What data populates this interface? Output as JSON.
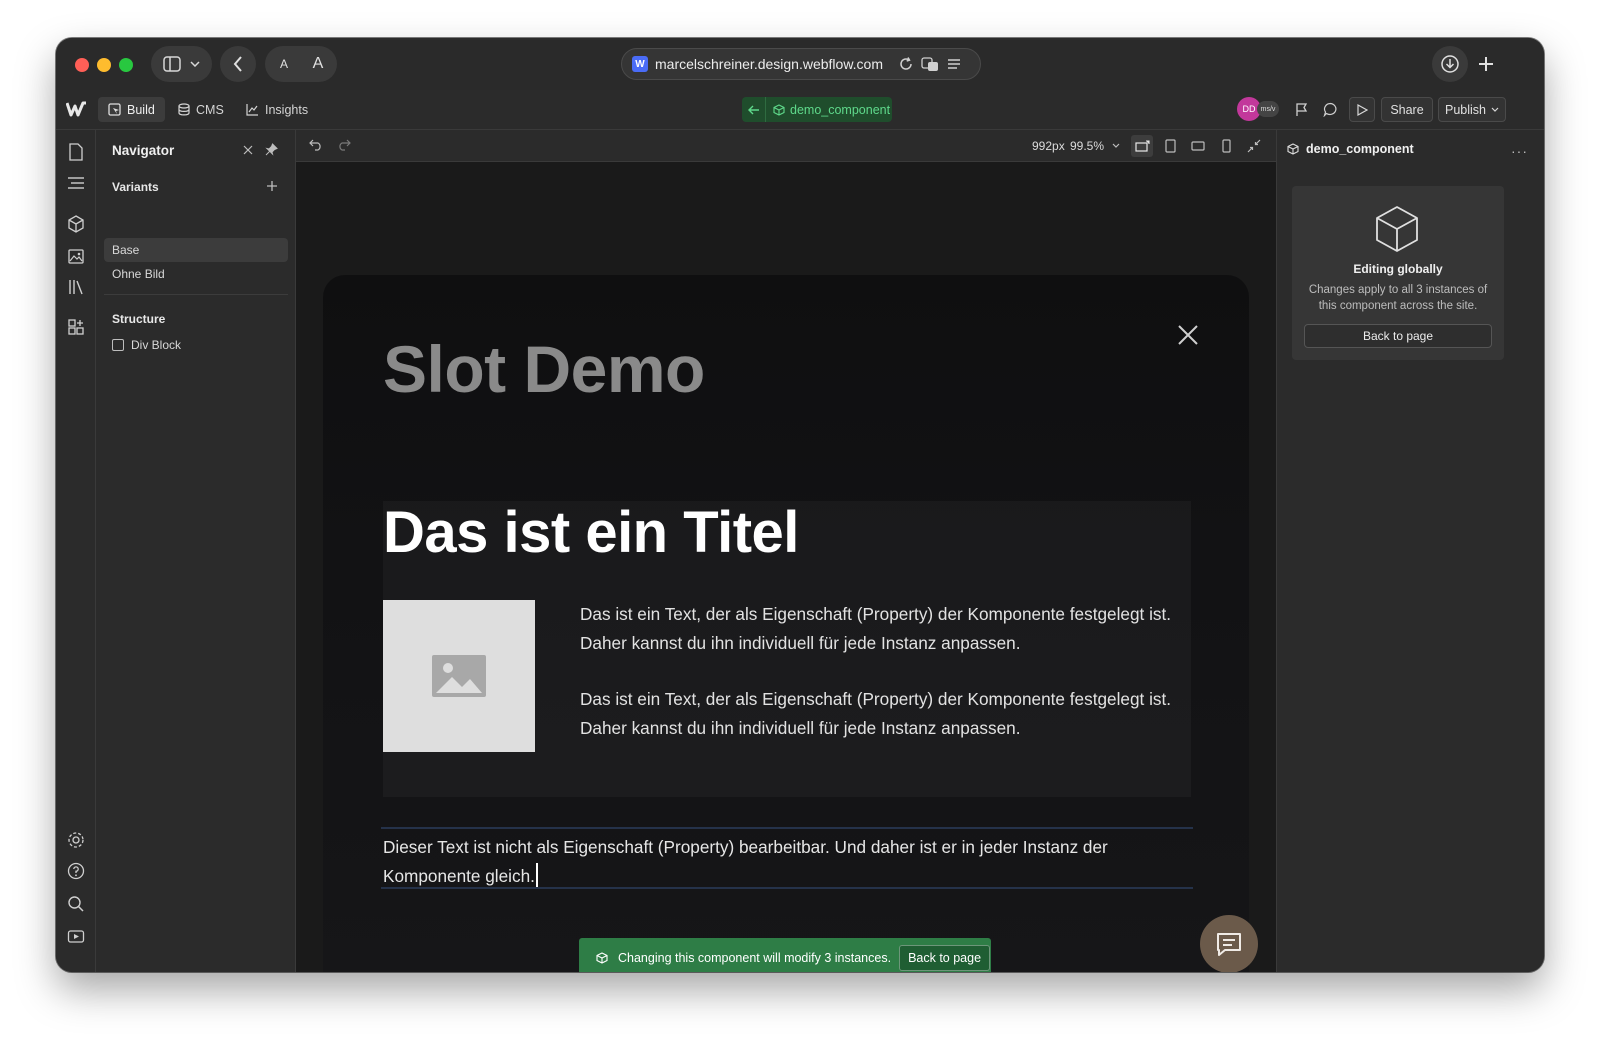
{
  "browser": {
    "url": "marcelschreiner.design.webflow.com",
    "favicon_letter": "W",
    "font_small_label": "A",
    "font_large_label": "A"
  },
  "toolbar": {
    "tabs": [
      {
        "label": "Build",
        "icon": "build-icon",
        "active": true
      },
      {
        "label": "CMS",
        "icon": "database-icon",
        "active": false
      },
      {
        "label": "Insights",
        "icon": "chart-icon",
        "active": false
      }
    ],
    "component_name": "demo_component",
    "avatar_initials": "DD",
    "avatar_secondary": "ms/v",
    "share_label": "Share",
    "publish_label": "Publish"
  },
  "navigator": {
    "title": "Navigator",
    "variants_label": "Variants",
    "variants": [
      "Base",
      "Ohne Bild"
    ],
    "structure_label": "Structure",
    "structure_items": [
      "Div Block"
    ]
  },
  "canvas": {
    "size_label": "992px",
    "zoom_label": "99.5%",
    "slot_title": "Slot Demo",
    "main_title": "Das ist ein Titel",
    "paragraph_1": "Das ist ein Text, der als Eigenschaft (Property) der Komponente festgelegt ist. Daher kannst du ihn individuell für jede Instanz anpassen.",
    "paragraph_2": "Das ist ein Text, der als Eigenschaft (Property) der Komponente festgelegt ist. Daher kannst du ihn individuell für jede Instanz anpassen.",
    "editable_text": "Dieser Text ist nicht als Eigenschaft (Property) bearbeitbar. Und daher ist er in jeder Instanz der Komponente gleich.",
    "toast_text": "Changing this component will modify 3 instances.",
    "toast_button": "Back to page"
  },
  "right_panel": {
    "component_name": "demo_component",
    "editing_title": "Editing globally",
    "editing_desc": "Changes apply to all 3 instances of this component across the site.",
    "back_button": "Back to page"
  },
  "colors": {
    "accent_green": "#2e7d46",
    "component_green": "#5fd98b",
    "avatar_pink": "#c2389b"
  }
}
